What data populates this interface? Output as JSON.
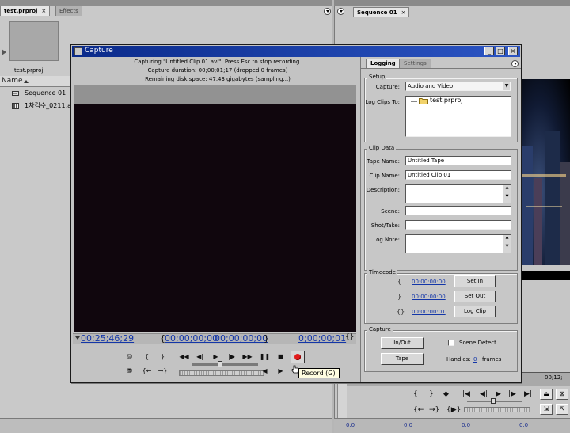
{
  "project_panel": {
    "tabs": [
      {
        "label": "test.prproj",
        "close": "×"
      },
      {
        "label": "Effects"
      }
    ],
    "project_name": "test.prproj",
    "column_name": "Name",
    "items": [
      {
        "label": "Sequence 01",
        "icon": "sequence-icon"
      },
      {
        "label": "1차검수_0211.a",
        "icon": "clip-icon"
      }
    ]
  },
  "monitor_panel": {
    "tab_label": "Sequence 01",
    "close": "×",
    "timecode_right": "00;12;",
    "zero_values": [
      "0.0",
      "0.0",
      "0.0",
      "0.0"
    ]
  },
  "capture": {
    "title": "Capture",
    "window_buttons": [
      "_",
      "□",
      "×"
    ],
    "status": {
      "line1": "Capturing \"Untitled Clip 01.avi\".  Press Esc to stop recording.",
      "line2": "Capture duration: 00;00;01;17  (dropped 0 frames)",
      "line3": "Remaining disk space: 47.43 gigabytes (sampling...)"
    },
    "timecodes": {
      "current": "00;25;46;29",
      "in_out": "00;00;00;00",
      "out": "00;00;00;00",
      "duration": "0;00;00;01"
    },
    "controls": {
      "set_in_glyph": "{",
      "set_out_glyph": "}",
      "goto_in_glyph": "{←",
      "goto_out_glyph": "→}",
      "rewind": "◀◀",
      "step_back": "◀|",
      "play": "▶",
      "step_fwd": "|▶",
      "fast_fwd": "▶▶",
      "pause": "❚❚",
      "stop": "■",
      "slow_rev": "◀",
      "slow_play": "▶"
    },
    "tooltip": "Record (G)",
    "logging": {
      "tabs": [
        "Logging",
        "Settings"
      ],
      "setup_title": "Setup",
      "capture_label": "Capture:",
      "capture_value": "Audio and Video",
      "log_clips_to_label": "Log Clips To:",
      "log_clips_to_value": "test.prproj",
      "clip_data_title": "Clip Data",
      "tape_name_label": "Tape Name:",
      "tape_name_value": "Untitled Tape",
      "clip_name_label": "Clip Name:",
      "clip_name_value": "Untitled Clip 01",
      "description_label": "Description:",
      "scene_label": "Scene:",
      "shot_take_label": "Shot/Take:",
      "log_note_label": "Log Note:",
      "timecode_title": "Timecode",
      "tc_in": "00:00:00:00",
      "tc_out": "00:00:00:00",
      "tc_dur": "00:00:00:01",
      "set_in": "Set In",
      "set_out": "Set Out",
      "log_clip": "Log Clip",
      "capture_title": "Capture",
      "in_out_btn": "In/Out",
      "tape_btn": "Tape",
      "scene_detect_label": "Scene Detect",
      "handles_label": "Handles:",
      "handles_value": "0",
      "frames_label": "frames"
    }
  }
}
